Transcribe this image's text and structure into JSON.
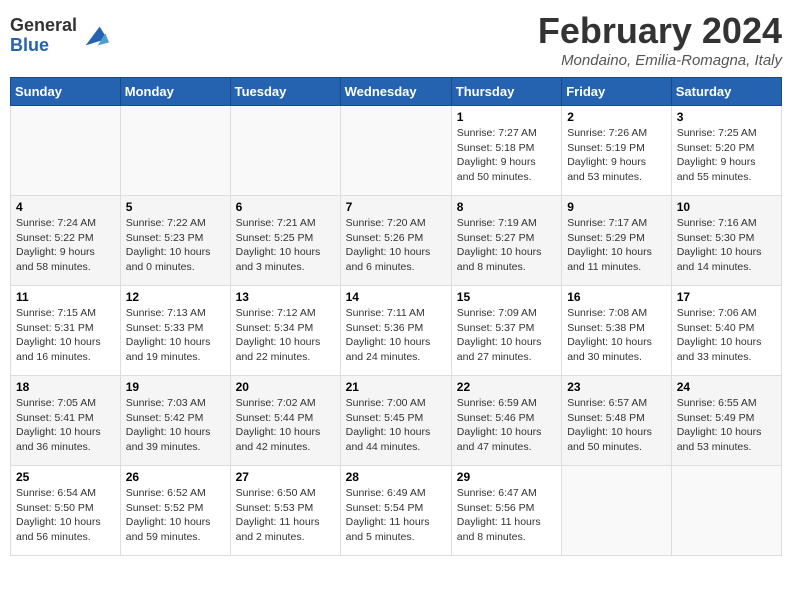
{
  "header": {
    "logo": {
      "line1": "General",
      "line2": "Blue"
    },
    "title": "February 2024",
    "location": "Mondaino, Emilia-Romagna, Italy"
  },
  "columns": [
    "Sunday",
    "Monday",
    "Tuesday",
    "Wednesday",
    "Thursday",
    "Friday",
    "Saturday"
  ],
  "weeks": [
    [
      {
        "day": "",
        "info": ""
      },
      {
        "day": "",
        "info": ""
      },
      {
        "day": "",
        "info": ""
      },
      {
        "day": "",
        "info": ""
      },
      {
        "day": "1",
        "info": "Sunrise: 7:27 AM\nSunset: 5:18 PM\nDaylight: 9 hours\nand 50 minutes."
      },
      {
        "day": "2",
        "info": "Sunrise: 7:26 AM\nSunset: 5:19 PM\nDaylight: 9 hours\nand 53 minutes."
      },
      {
        "day": "3",
        "info": "Sunrise: 7:25 AM\nSunset: 5:20 PM\nDaylight: 9 hours\nand 55 minutes."
      }
    ],
    [
      {
        "day": "4",
        "info": "Sunrise: 7:24 AM\nSunset: 5:22 PM\nDaylight: 9 hours\nand 58 minutes."
      },
      {
        "day": "5",
        "info": "Sunrise: 7:22 AM\nSunset: 5:23 PM\nDaylight: 10 hours\nand 0 minutes."
      },
      {
        "day": "6",
        "info": "Sunrise: 7:21 AM\nSunset: 5:25 PM\nDaylight: 10 hours\nand 3 minutes."
      },
      {
        "day": "7",
        "info": "Sunrise: 7:20 AM\nSunset: 5:26 PM\nDaylight: 10 hours\nand 6 minutes."
      },
      {
        "day": "8",
        "info": "Sunrise: 7:19 AM\nSunset: 5:27 PM\nDaylight: 10 hours\nand 8 minutes."
      },
      {
        "day": "9",
        "info": "Sunrise: 7:17 AM\nSunset: 5:29 PM\nDaylight: 10 hours\nand 11 minutes."
      },
      {
        "day": "10",
        "info": "Sunrise: 7:16 AM\nSunset: 5:30 PM\nDaylight: 10 hours\nand 14 minutes."
      }
    ],
    [
      {
        "day": "11",
        "info": "Sunrise: 7:15 AM\nSunset: 5:31 PM\nDaylight: 10 hours\nand 16 minutes."
      },
      {
        "day": "12",
        "info": "Sunrise: 7:13 AM\nSunset: 5:33 PM\nDaylight: 10 hours\nand 19 minutes."
      },
      {
        "day": "13",
        "info": "Sunrise: 7:12 AM\nSunset: 5:34 PM\nDaylight: 10 hours\nand 22 minutes."
      },
      {
        "day": "14",
        "info": "Sunrise: 7:11 AM\nSunset: 5:36 PM\nDaylight: 10 hours\nand 24 minutes."
      },
      {
        "day": "15",
        "info": "Sunrise: 7:09 AM\nSunset: 5:37 PM\nDaylight: 10 hours\nand 27 minutes."
      },
      {
        "day": "16",
        "info": "Sunrise: 7:08 AM\nSunset: 5:38 PM\nDaylight: 10 hours\nand 30 minutes."
      },
      {
        "day": "17",
        "info": "Sunrise: 7:06 AM\nSunset: 5:40 PM\nDaylight: 10 hours\nand 33 minutes."
      }
    ],
    [
      {
        "day": "18",
        "info": "Sunrise: 7:05 AM\nSunset: 5:41 PM\nDaylight: 10 hours\nand 36 minutes."
      },
      {
        "day": "19",
        "info": "Sunrise: 7:03 AM\nSunset: 5:42 PM\nDaylight: 10 hours\nand 39 minutes."
      },
      {
        "day": "20",
        "info": "Sunrise: 7:02 AM\nSunset: 5:44 PM\nDaylight: 10 hours\nand 42 minutes."
      },
      {
        "day": "21",
        "info": "Sunrise: 7:00 AM\nSunset: 5:45 PM\nDaylight: 10 hours\nand 44 minutes."
      },
      {
        "day": "22",
        "info": "Sunrise: 6:59 AM\nSunset: 5:46 PM\nDaylight: 10 hours\nand 47 minutes."
      },
      {
        "day": "23",
        "info": "Sunrise: 6:57 AM\nSunset: 5:48 PM\nDaylight: 10 hours\nand 50 minutes."
      },
      {
        "day": "24",
        "info": "Sunrise: 6:55 AM\nSunset: 5:49 PM\nDaylight: 10 hours\nand 53 minutes."
      }
    ],
    [
      {
        "day": "25",
        "info": "Sunrise: 6:54 AM\nSunset: 5:50 PM\nDaylight: 10 hours\nand 56 minutes."
      },
      {
        "day": "26",
        "info": "Sunrise: 6:52 AM\nSunset: 5:52 PM\nDaylight: 10 hours\nand 59 minutes."
      },
      {
        "day": "27",
        "info": "Sunrise: 6:50 AM\nSunset: 5:53 PM\nDaylight: 11 hours\nand 2 minutes."
      },
      {
        "day": "28",
        "info": "Sunrise: 6:49 AM\nSunset: 5:54 PM\nDaylight: 11 hours\nand 5 minutes."
      },
      {
        "day": "29",
        "info": "Sunrise: 6:47 AM\nSunset: 5:56 PM\nDaylight: 11 hours\nand 8 minutes."
      },
      {
        "day": "",
        "info": ""
      },
      {
        "day": "",
        "info": ""
      }
    ]
  ]
}
